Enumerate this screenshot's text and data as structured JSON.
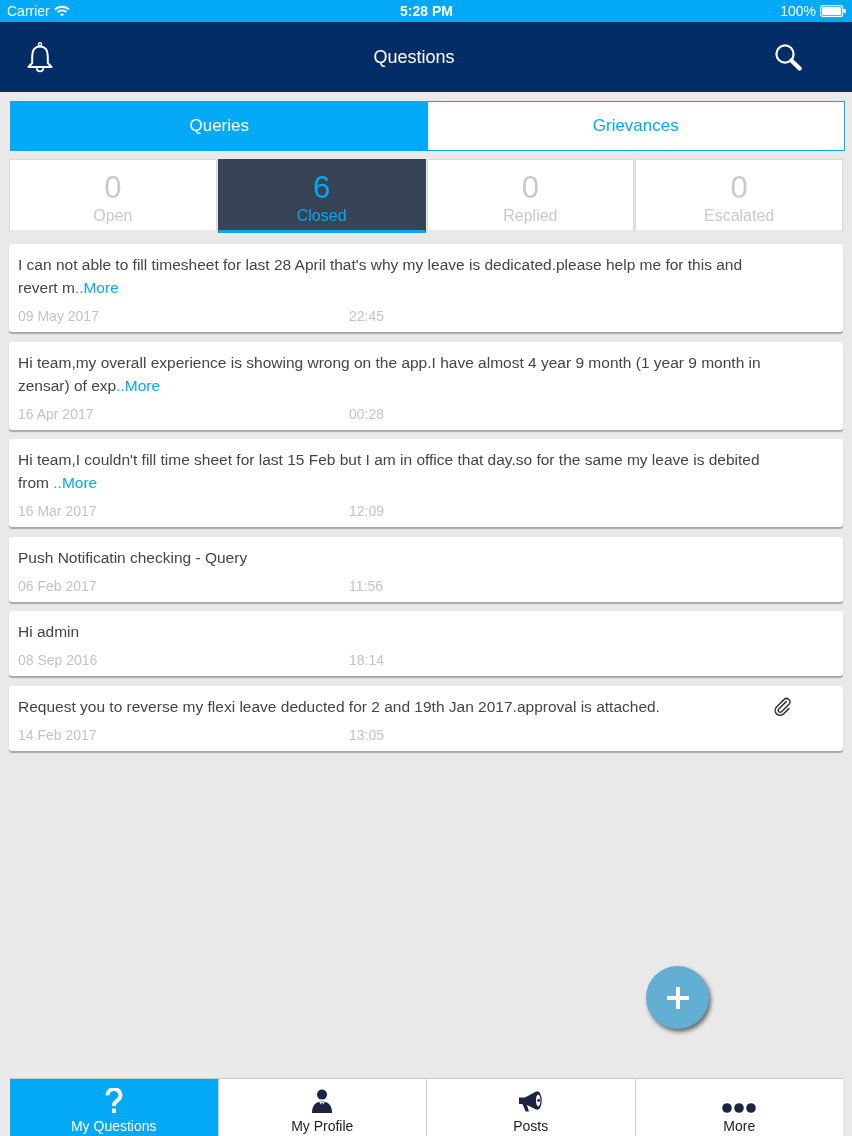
{
  "status_bar": {
    "carrier": "Carrier",
    "time": "5:28 PM",
    "battery": "100%"
  },
  "nav_bar": {
    "title": "Questions"
  },
  "segments": [
    {
      "label": "Queries",
      "selected": true
    },
    {
      "label": "Grievances",
      "selected": false
    }
  ],
  "status_tabs": [
    {
      "count": "0",
      "label": "Open",
      "selected": false
    },
    {
      "count": "6",
      "label": "Closed",
      "selected": true
    },
    {
      "count": "0",
      "label": "Replied",
      "selected": false
    },
    {
      "count": "0",
      "label": "Escalated",
      "selected": false
    }
  ],
  "questions": [
    {
      "text": "I can not able to fill timesheet for last 28 April that's why my leave is dedicated.please help me for this and revert m",
      "more": "..More",
      "date": "09 May 2017",
      "time": "22:45",
      "attachment": false
    },
    {
      "text": "Hi team,my overall experience is showing wrong on the app.I have almost 4 year 9 month (1 year 9 month in zensar) of exp",
      "more": "..More",
      "date": "16 Apr 2017",
      "time": "00:28",
      "attachment": false
    },
    {
      "text": "Hi team,I couldn't fill time sheet for last 15 Feb but I am in office that day.so for the same my leave is debited from ",
      "more": "..More",
      "date": "16 Mar 2017",
      "time": "12:09",
      "attachment": false
    },
    {
      "text": "Push Notificatin checking - Query",
      "date": "06 Feb 2017",
      "time": "11:56",
      "attachment": false
    },
    {
      "text": "Hi admin",
      "date": "08 Sep 2016",
      "time": "18:14",
      "attachment": false
    },
    {
      "text": "Request you to reverse my flexi leave deducted for 2 and 19th Jan 2017.approval is attached.",
      "date": "14 Feb 2017",
      "time": "13:05",
      "attachment": true
    }
  ],
  "tab_bar": [
    {
      "label": "My Questions",
      "selected": true
    },
    {
      "label": "My Profile",
      "selected": false
    },
    {
      "label": "Posts",
      "selected": false
    },
    {
      "label": "More",
      "selected": false
    }
  ]
}
